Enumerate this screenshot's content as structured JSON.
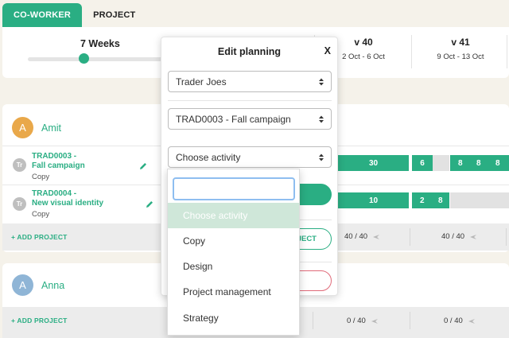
{
  "tabs": [
    {
      "label": "CO-WORKER",
      "active": true
    },
    {
      "label": "PROJECT",
      "active": false
    }
  ],
  "header": {
    "weeks_label": "7 Weeks",
    "slider_value_fraction": 0.4,
    "weeks": [
      {
        "label": "v 40",
        "dates": "2 Oct - 6 Oct"
      },
      {
        "label": "v 41",
        "dates": "9 Oct - 13 Oct"
      }
    ]
  },
  "people": [
    {
      "initial": "A",
      "name": "Amit",
      "avatar_color": "#e9a84a",
      "projects": [
        {
          "badge": "Tr",
          "title_line1": "TRAD0003 -",
          "title_line2": "Fall campaign",
          "activity": "Copy",
          "bar_value": "30",
          "week41_values": [
            "6",
            "8",
            "8",
            "8"
          ]
        },
        {
          "badge": "Tr",
          "title_line1": "TRAD0004 -",
          "title_line2": "New visual identity",
          "activity": "Copy",
          "bar_value": "10",
          "week41_values": [
            "2",
            "8"
          ]
        }
      ],
      "add_project_label": "ADD PROJECT",
      "capacity": [
        "40 / 40",
        "40 / 40"
      ]
    },
    {
      "initial": "A",
      "name": "Anna",
      "avatar_color": "#8fb5d6",
      "add_project_label": "ADD PROJECT",
      "capacity": [
        "0 / 40",
        "0 / 40"
      ]
    }
  ],
  "modal": {
    "title": "Edit planning",
    "close_label": "X",
    "client_select": "Trader Joes",
    "project_select": "TRAD0003 - Fall campaign",
    "activity_select": "Choose activity",
    "outline_button_partial": "JECT"
  },
  "activity_dropdown": {
    "search_value": "",
    "options": [
      "Choose activity",
      "Copy",
      "Design",
      "Project management",
      "Strategy"
    ],
    "selected_index": 0
  },
  "colors": {
    "accent": "#2aae83",
    "danger": "#e06b7a"
  }
}
